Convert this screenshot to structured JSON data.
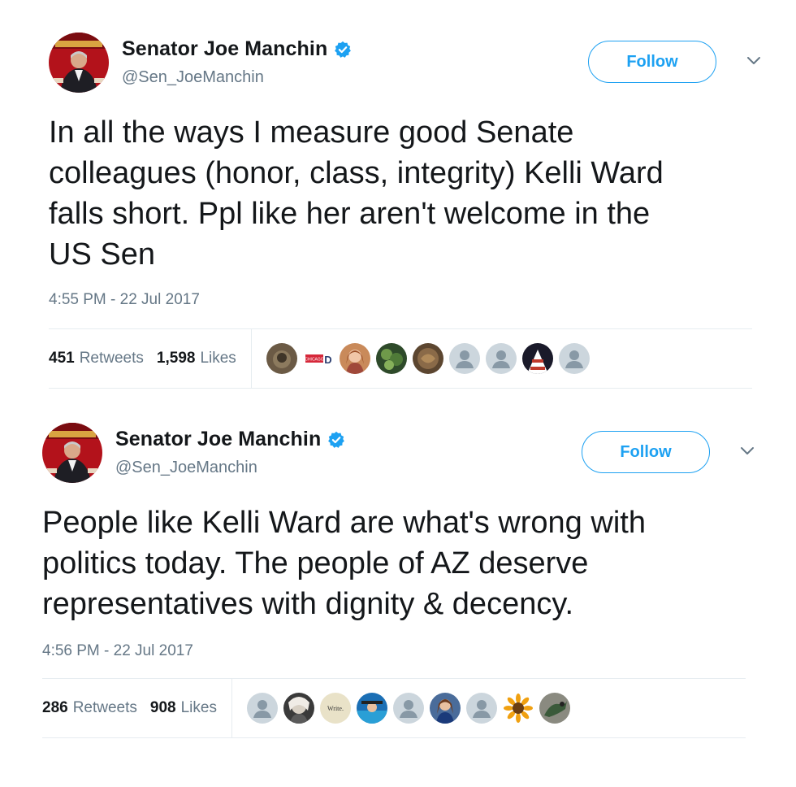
{
  "tweets": [
    {
      "display_name": "Senator Joe Manchin",
      "handle": "@Sen_JoeManchin",
      "follow_label": "Follow",
      "text": "In all the ways I measure good Senate\ncolleagues (honor, class, integrity) Kelli Ward\nfalls short. Ppl like her aren't welcome in the\nUS Sen",
      "timestamp": "4:55 PM - 22 Jul 2017",
      "retweets_count": "451",
      "retweets_label": "Retweets",
      "likes_count": "1,598",
      "likes_label": "Likes",
      "likers": [
        "photo-avatar",
        "logo-avatar",
        "photo-avatar",
        "photo-avatar",
        "photo-avatar",
        "default-avatar",
        "default-avatar",
        "photo-avatar",
        "default-avatar"
      ]
    },
    {
      "display_name": "Senator Joe Manchin",
      "handle": "@Sen_JoeManchin",
      "follow_label": "Follow",
      "text": "People like Kelli Ward are what's wrong with\npolitics today. The people of AZ deserve\nrepresentatives with dignity & decency.",
      "timestamp": "4:56 PM - 22 Jul 2017",
      "retweets_count": "286",
      "retweets_label": "Retweets",
      "likes_count": "908",
      "likes_label": "Likes",
      "likers": [
        "default-avatar",
        "photo-avatar",
        "logo-avatar",
        "photo-avatar",
        "default-avatar",
        "photo-avatar",
        "default-avatar",
        "sunflower-avatar",
        "photo-avatar"
      ]
    }
  ],
  "logo_text": {
    "liker_logo_1": "CHICAGO",
    "liker_logo_2": "Write."
  },
  "colors": {
    "accent": "#1da1f2",
    "text_primary": "#14171a",
    "text_secondary": "#657786",
    "divider": "#e6ecf0",
    "avatar_background": "#b3121b"
  }
}
